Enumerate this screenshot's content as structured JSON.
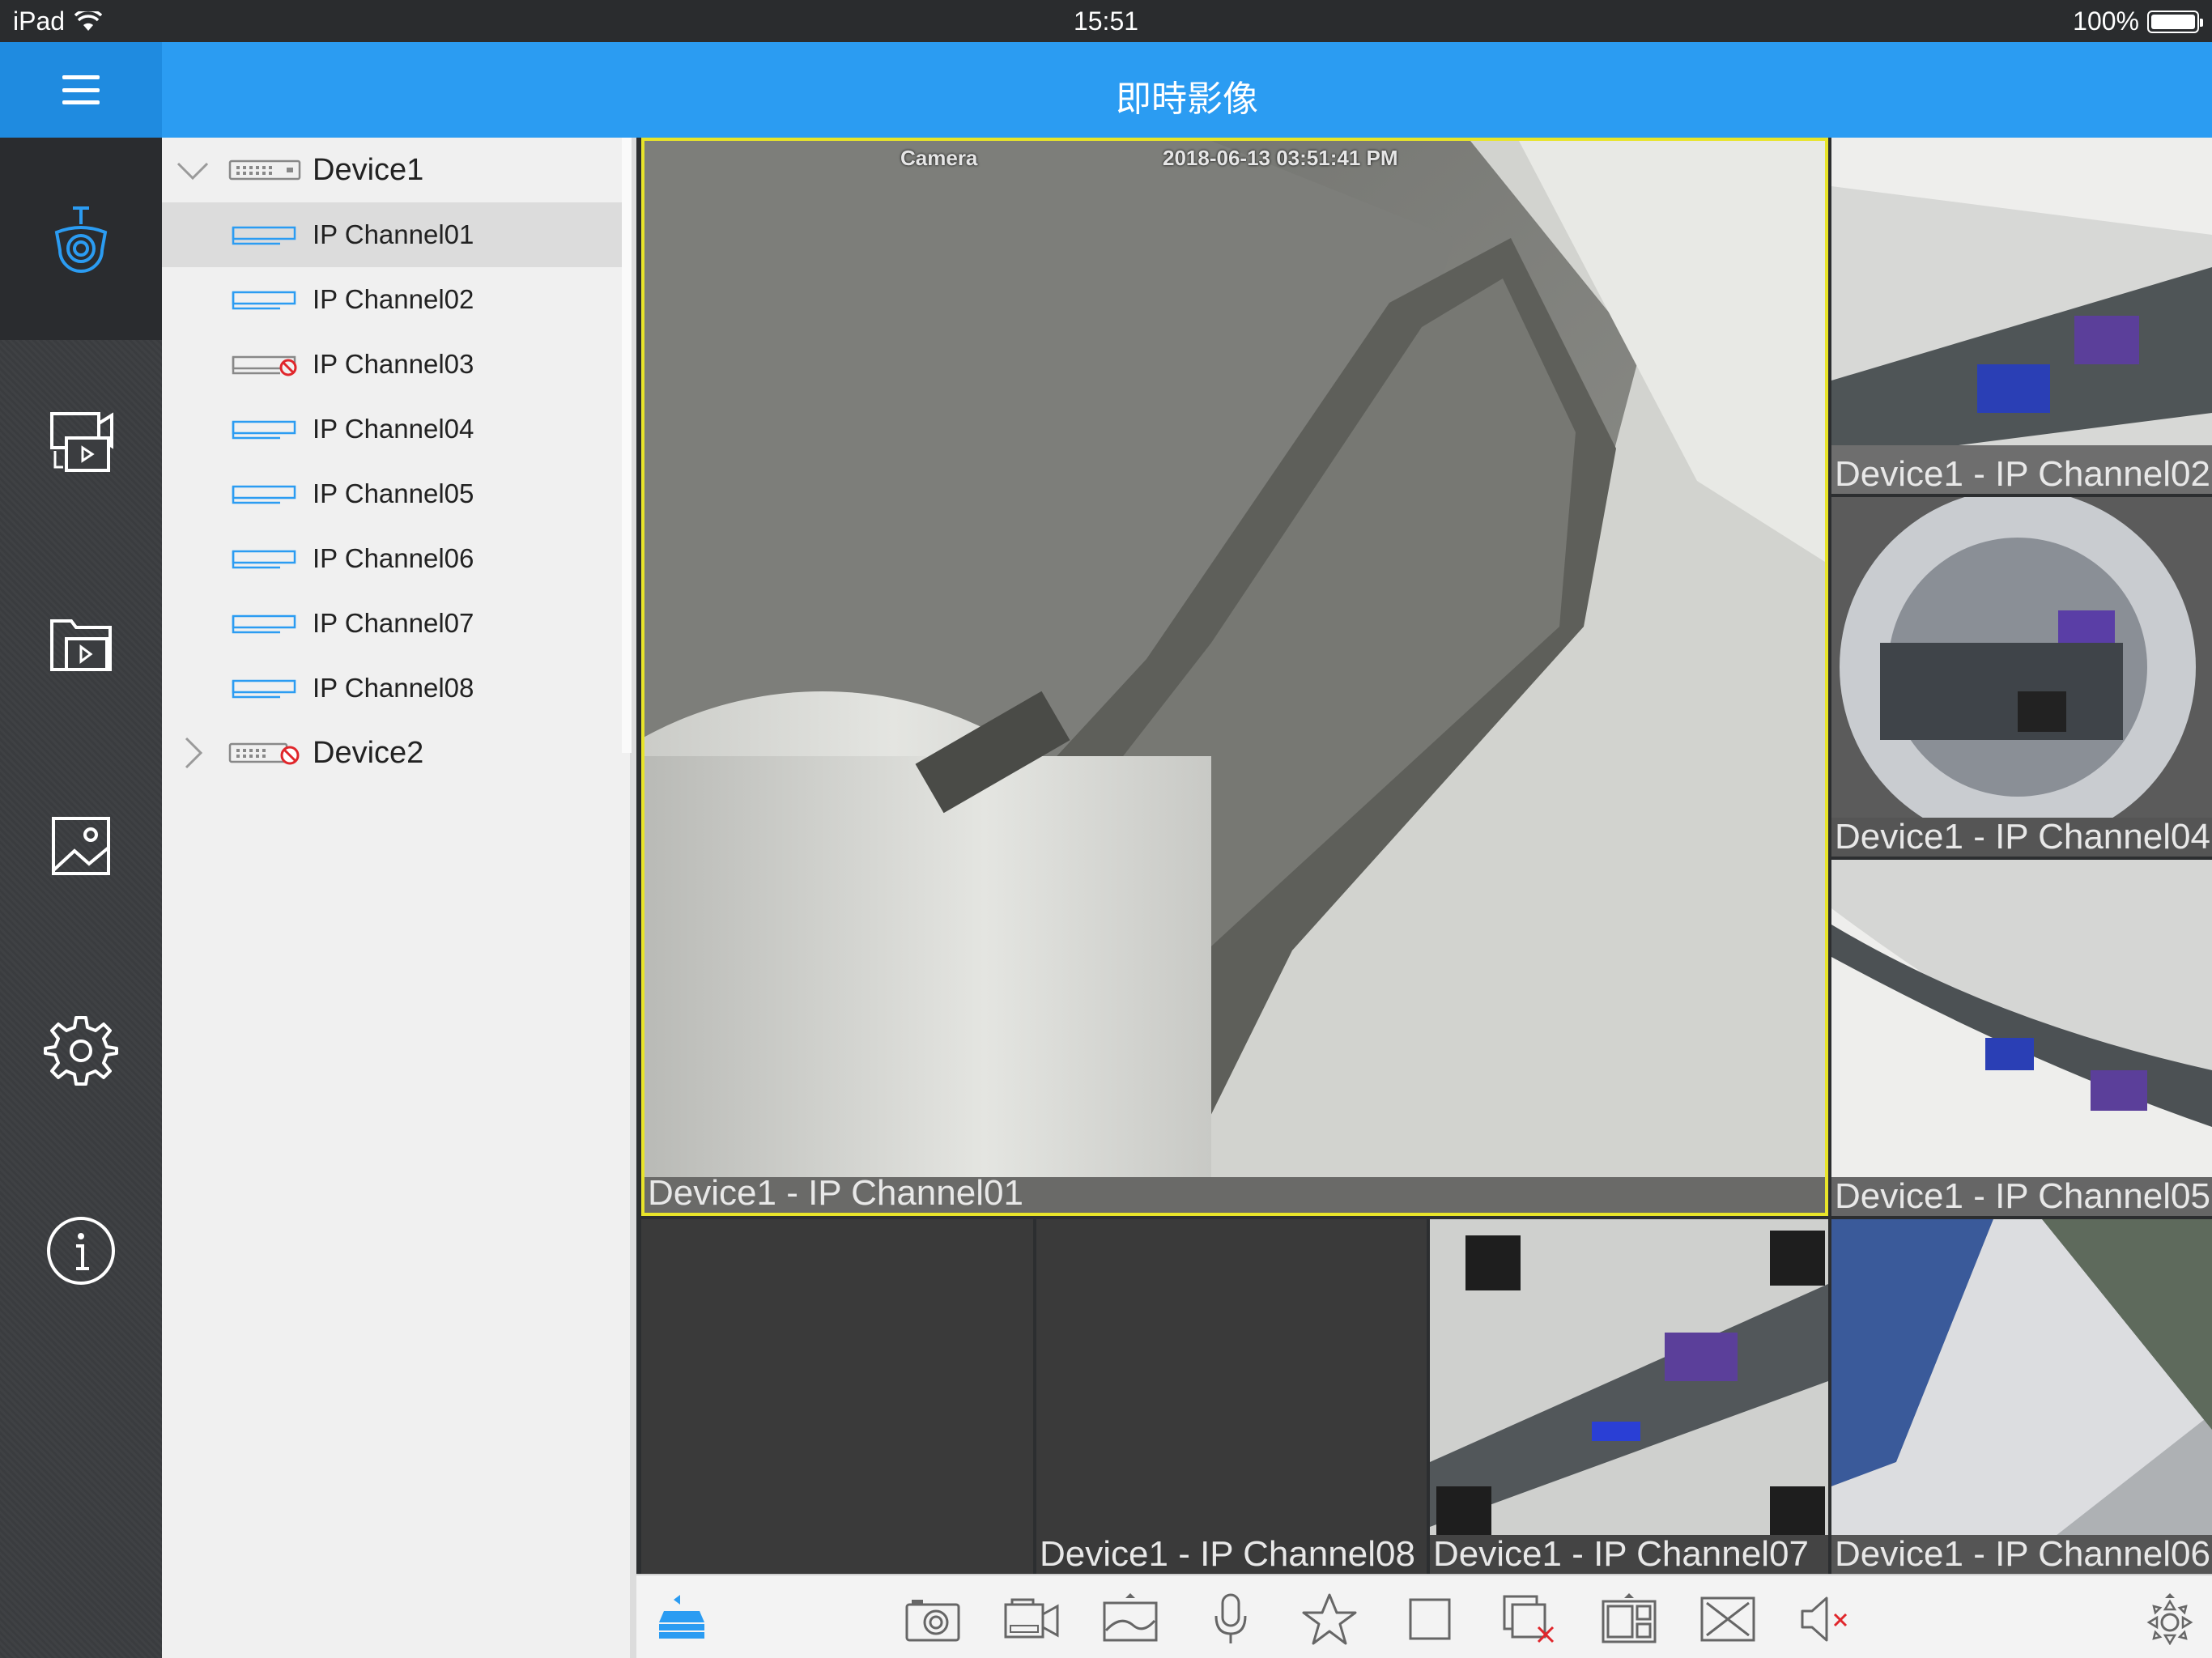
{
  "status_bar": {
    "device": "iPad",
    "time": "15:51",
    "battery": "100%"
  },
  "header": {
    "title": "即時影像"
  },
  "rail": {
    "items": [
      {
        "icon": "camera-icon",
        "active": true
      },
      {
        "icon": "playback-icon"
      },
      {
        "icon": "video-folder-icon"
      },
      {
        "icon": "picture-icon"
      },
      {
        "icon": "settings-icon"
      },
      {
        "icon": "info-icon"
      }
    ]
  },
  "tree": {
    "device1": {
      "label": "Device1",
      "expanded": true,
      "online": true
    },
    "channels": [
      {
        "label": "IP Channel01",
        "online": true,
        "selected": true
      },
      {
        "label": "IP Channel02",
        "online": true
      },
      {
        "label": "IP Channel03",
        "online": false
      },
      {
        "label": "IP Channel04",
        "online": true
      },
      {
        "label": "IP Channel05",
        "online": true
      },
      {
        "label": "IP Channel06",
        "online": true
      },
      {
        "label": "IP Channel07",
        "online": true
      },
      {
        "label": "IP Channel08",
        "online": true
      }
    ],
    "device2": {
      "label": "Device2",
      "expanded": false,
      "online": false
    }
  },
  "grid": {
    "main": {
      "caption": "Device1 - IP Channel01",
      "osd_name": "Camera",
      "osd_time": "2018-06-13 03:51:41 PM"
    },
    "tiles": [
      {
        "id": "t2",
        "caption": "Device1 - IP Channel02"
      },
      {
        "id": "t4",
        "caption": "Device1 - IP Channel04"
      },
      {
        "id": "t5",
        "caption": "Device1 - IP Channel05"
      },
      {
        "id": "t-empty",
        "caption": ""
      },
      {
        "id": "t8",
        "caption": "Device1 - IP Channel08"
      },
      {
        "id": "t7",
        "caption": "Device1 - IP Channel07"
      },
      {
        "id": "t6",
        "caption": "Device1 - IP Channel06"
      }
    ]
  },
  "toolbar": {
    "items": [
      "device-list-icon",
      "snapshot-icon",
      "record-icon",
      "image-quality-icon",
      "microphone-icon",
      "favorite-icon",
      "window-icon",
      "close-window-icon",
      "layout-icon",
      "fullscreen-icon",
      "mute-icon",
      "ptz-icon"
    ]
  },
  "colors": {
    "accent": "#2b9cf2",
    "selected_border": "#e8e42a",
    "offline": "#e0262b"
  }
}
